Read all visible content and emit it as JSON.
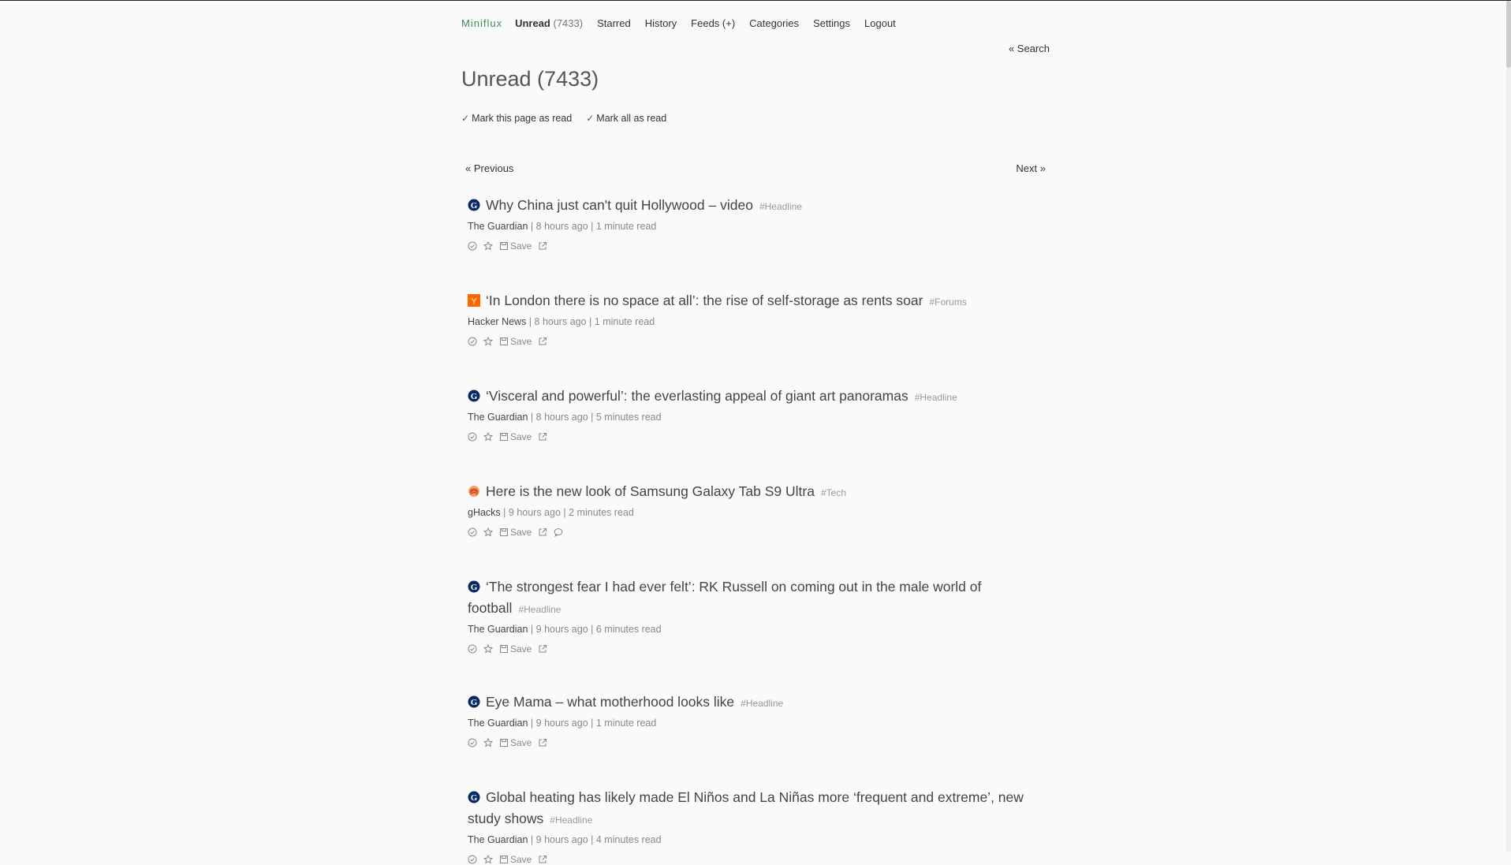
{
  "nav": {
    "brand": "Miniflux",
    "unread_label": "Unread",
    "unread_count": "(7433)",
    "starred": "Starred",
    "history": "History",
    "feeds": "Feeds (+)",
    "categories": "Categories",
    "settings": "Settings",
    "logout": "Logout"
  },
  "search_link": "« Search",
  "page_title": "Unread (7433)",
  "page_actions": {
    "mark_page": "Mark this page as read",
    "mark_all": "Mark all as read"
  },
  "pagination": {
    "previous": "« Previous",
    "next": "Next »"
  },
  "entries": [
    {
      "title": "Why China just can't quit Hollywood – video",
      "tag": "#Headline",
      "feed": "The Guardian",
      "time": "8 hours ago",
      "read": "1 minute read",
      "icon": "guardian-icon",
      "save": "Save"
    },
    {
      "title": "‘In London there is no space at all’: the rise of self-storage as rents soar",
      "tag": "#Forums",
      "feed": "Hacker News",
      "time": "8 hours ago",
      "read": "1 minute read",
      "icon": "hacker-news-icon",
      "save": "Save"
    },
    {
      "title": "‘Visceral and powerful’: the everlasting appeal of giant art panoramas",
      "tag": "#Headline",
      "feed": "The Guardian",
      "time": "8 hours ago",
      "read": "5 minutes read",
      "icon": "guardian-icon",
      "save": "Save"
    },
    {
      "title": "Here is the new look of Samsung Galaxy Tab S9 Ultra",
      "tag": "#Tech",
      "feed": "gHacks",
      "time": "9 hours ago",
      "read": "2 minutes read",
      "icon": "ghacks-icon",
      "save": "Save"
    },
    {
      "title": "‘The strongest fear I had ever felt’: RK Russell on coming out in the male world of football",
      "tag": "#Headline",
      "feed": "The Guardian",
      "time": "9 hours ago",
      "read": "6 minutes read",
      "icon": "guardian-icon",
      "save": "Save"
    },
    {
      "title": "Eye Mama – what motherhood looks like",
      "tag": "#Headline",
      "feed": "The Guardian",
      "time": "9 hours ago",
      "read": "1 minute read",
      "icon": "guardian-icon",
      "save": "Save"
    },
    {
      "title": "Global heating has likely made El Niños and La Niñas more ‘frequent and extreme’, new study shows",
      "tag": "#Headline",
      "feed": "The Guardian",
      "time": "9 hours ago",
      "read": "4 minutes read",
      "icon": "guardian-icon",
      "save": "Save"
    }
  ],
  "colors": {
    "brand": "#3c8a5a",
    "guardian": "#052962",
    "hacker_news": "#ff6600"
  }
}
